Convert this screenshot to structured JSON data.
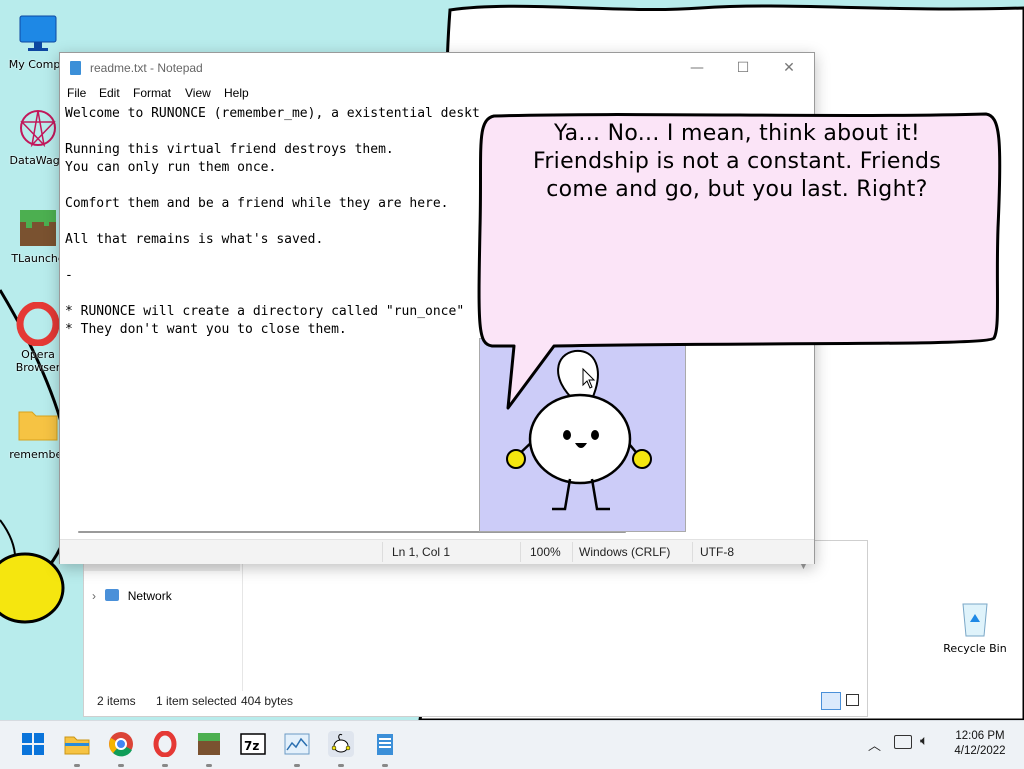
{
  "desktop": {
    "icons": [
      {
        "label": "My Compu"
      },
      {
        "label": "DataWago"
      },
      {
        "label": "TLaunche"
      },
      {
        "label": "Opera Browser"
      },
      {
        "label": "remember"
      },
      {
        "label": "Recycle Bin"
      }
    ]
  },
  "explorer": {
    "nav_network": "Network",
    "status_items": "2 items",
    "status_selected": "1 item selected",
    "status_size": "404 bytes"
  },
  "notepad": {
    "title": "readme.txt - Notepad",
    "menu": [
      "File",
      "Edit",
      "Format",
      "View",
      "Help"
    ],
    "lines": [
      "Welcome to RUNONCE (remember_me), a existential deskt",
      "",
      "Running this virtual friend destroys them.",
      "You can only run them once.",
      "",
      "Comfort them and be a friend while they are here.",
      "",
      "All that remains is what's saved.",
      "",
      "-",
      "",
      "* RUNONCE will create a directory called \"run_once\"",
      "* They don't want you to close them."
    ],
    "status": {
      "position": "Ln 1, Col 1",
      "zoom": "100%",
      "line_ending": "Windows (CRLF)",
      "encoding": "UTF-8"
    }
  },
  "bubble": {
    "lines": [
      "Ya... No... I mean, think about it!",
      "Friendship is not a constant. Friends",
      "come and go, but you last. Right?"
    ]
  },
  "taskbar": {
    "apps": [
      "start-icon",
      "file-explorer-icon",
      "chrome-icon",
      "opera-icon",
      "minecraft-icon",
      "7zip-icon",
      "chart-app-icon",
      "runonce-icon",
      "notepad-icon"
    ],
    "time": "12:06 PM",
    "date": "4/12/2022"
  },
  "colors": {
    "desktop_bg": "#b8ecec",
    "bubble_fill": "#fbe4f7",
    "friend_bg": "#ccccf8",
    "yellow": "#f5e60f"
  }
}
